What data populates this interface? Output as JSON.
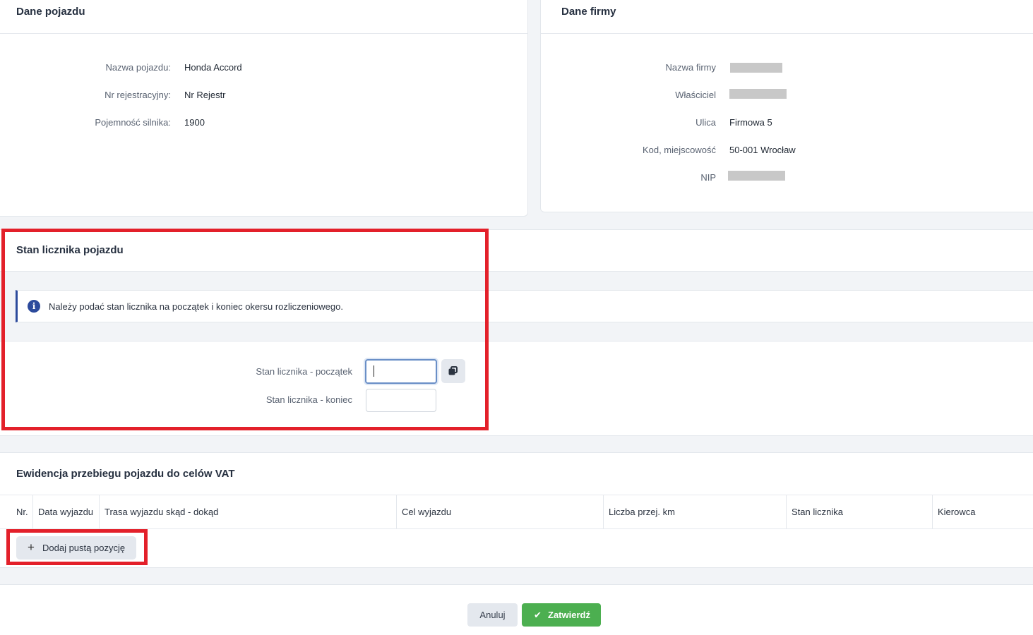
{
  "vehicle": {
    "title": "Dane pojazdu",
    "fields": [
      {
        "label": "Nazwa pojazdu:",
        "value": "Honda Accord"
      },
      {
        "label": "Nr rejestracyjny:",
        "value": "Nr Rejestr"
      },
      {
        "label": "Pojemność silnika:",
        "value": "1900"
      }
    ]
  },
  "company": {
    "title": "Dane firmy",
    "fields": [
      {
        "label": "Nazwa firmy",
        "value": null,
        "redacted": true
      },
      {
        "label": "Właściciel",
        "value": null,
        "redacted": true
      },
      {
        "label": "Ulica",
        "value": "Firmowa 5"
      },
      {
        "label": "Kod, miejscowość",
        "value": "50-001 Wrocław"
      },
      {
        "label": "NIP",
        "value": null,
        "redacted": true
      }
    ]
  },
  "odometer": {
    "title": "Stan licznika pojazdu",
    "info": "Należy podać stan licznika na początek i koniec okersu rozliczeniowego.",
    "start_label": "Stan licznika - początek",
    "start_value": "",
    "end_label": "Stan licznika - koniec",
    "end_value": ""
  },
  "mileage": {
    "title": "Ewidencja przebiegu pojazdu do celów VAT",
    "columns": [
      "Nr.",
      "Data wyjazdu",
      "Trasa wyjazdu skąd - dokąd",
      "Cel wyjazdu",
      "Liczba przej. km",
      "Stan licznika",
      "Kierowca"
    ],
    "add_button": "Dodaj pustą pozycję"
  },
  "footer": {
    "cancel": "Anuluj",
    "confirm": "Zatwierdź"
  },
  "colors": {
    "highlight": "#e3202a",
    "confirm": "#4caf50",
    "info_accent": "#2c4a9c"
  },
  "icons": [
    "info-icon",
    "copy-icon",
    "plus-icon",
    "check-icon"
  ]
}
